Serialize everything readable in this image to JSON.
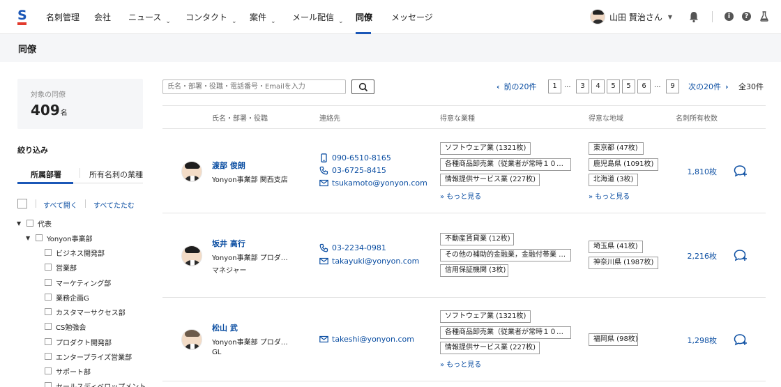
{
  "nav": {
    "logo_letter": "S",
    "items": [
      {
        "label": "名刺管理",
        "has_caret": false
      },
      {
        "label": "会社",
        "has_caret": false
      },
      {
        "label": "ニュース",
        "has_caret": true
      },
      {
        "label": "コンタクト",
        "has_caret": true
      },
      {
        "label": "案件",
        "has_caret": true
      },
      {
        "label": "メール配信",
        "has_caret": true
      },
      {
        "label": "同僚",
        "has_caret": false,
        "active": true
      },
      {
        "label": "メッセージ",
        "has_caret": false
      }
    ],
    "caret_glyph": "⌄",
    "user_name": "山田 賢治さん",
    "user_caret": "▼",
    "info_glyph": "i",
    "help_glyph": "?"
  },
  "page": {
    "title": "同僚"
  },
  "sidebar": {
    "count_label": "対象の同僚",
    "count_value": "409",
    "count_unit": "名",
    "filter_title": "絞り込み",
    "tabs": [
      "所属部署",
      "所有名刺の業種"
    ],
    "expand_all": "すべて開く",
    "collapse_all": "すべてたたむ",
    "tree": [
      {
        "label": "代表",
        "level": 0,
        "expanded": true
      },
      {
        "label": "Yonyon事業部",
        "level": 1,
        "expanded": true
      },
      {
        "label": "ビジネス開発部",
        "level": 2
      },
      {
        "label": "営業部",
        "level": 2
      },
      {
        "label": "マーケティング部",
        "level": 2
      },
      {
        "label": "業務企画G",
        "level": 2
      },
      {
        "label": "カスタマーサクセス部",
        "level": 2
      },
      {
        "label": "CS勉強会",
        "level": 2
      },
      {
        "label": "プロダクト開発部",
        "level": 2
      },
      {
        "label": "エンタープライズ営業部",
        "level": 2
      },
      {
        "label": "サポート部",
        "level": 2
      },
      {
        "label": "セールスディベロップメント",
        "level": 2
      }
    ]
  },
  "search": {
    "placeholder": "氏名・部署・役職・電話番号・Emailを入力"
  },
  "pagination": {
    "prev": "前の20件",
    "next": "次の20件",
    "pages": [
      "1",
      "3",
      "4",
      "5",
      "5",
      "6",
      "9"
    ],
    "ellipsis": "...",
    "total": "全30件"
  },
  "table": {
    "headers": [
      "氏名・部署・役職",
      "連絡先",
      "得意な業種",
      "得意な地域",
      "名刺所有枚数"
    ],
    "rows": [
      {
        "name": "渡部 俊朗",
        "dept": "Yonyon事業部 関西支店",
        "title": "",
        "mobile": "090-6510-8165",
        "phone": "03-6725-8415",
        "email": "tsukamoto@yonyon.com",
        "industries": [
          "ソフトウェア業 (1321枚)",
          "各種商品卸売業（従業者が常時１０…",
          "情報提供サービス業 (227枚)"
        ],
        "industries_more": "» もっと見る",
        "regions": [
          "東京都 (47枚)",
          "鹿児島県 (1091枚)",
          "北海道 (3枚)"
        ],
        "regions_more": "» もっと見る",
        "card_count": "1,810枚"
      },
      {
        "name": "坂井 高行",
        "dept": "Yonyon事業部 プロダ…",
        "title": "マネジャー",
        "mobile": "",
        "phone": "03-2234-0981",
        "email": "takayuki@yonyon.com",
        "industries": [
          "不動産賃貸業 (12枚)",
          "その他の補助的金融業，金融付帯業 …",
          "信用保証機関 (3枚)"
        ],
        "industries_more": "",
        "regions": [
          "埼玉県 (41枚)",
          "神奈川県 (1987枚)"
        ],
        "regions_more": "",
        "card_count": "2,216枚"
      },
      {
        "name": "松山 武",
        "dept": "Yonyon事業部 プロダ…",
        "title": "GL",
        "mobile": "",
        "phone": "",
        "email": "takeshi@yonyon.com",
        "industries": [
          "ソフトウェア業 (1321枚)",
          "各種商品卸売業（従業者が常時１０…",
          "情報提供サービス業 (227枚)"
        ],
        "industries_more": "» もっと見る",
        "regions": [
          "福岡県 (98枚)"
        ],
        "regions_more": "",
        "card_count": "1,298枚"
      }
    ]
  },
  "colors": {
    "accent": "#1b57b7",
    "link": "#0b4ea2",
    "logo_red": "#e23b2e"
  }
}
